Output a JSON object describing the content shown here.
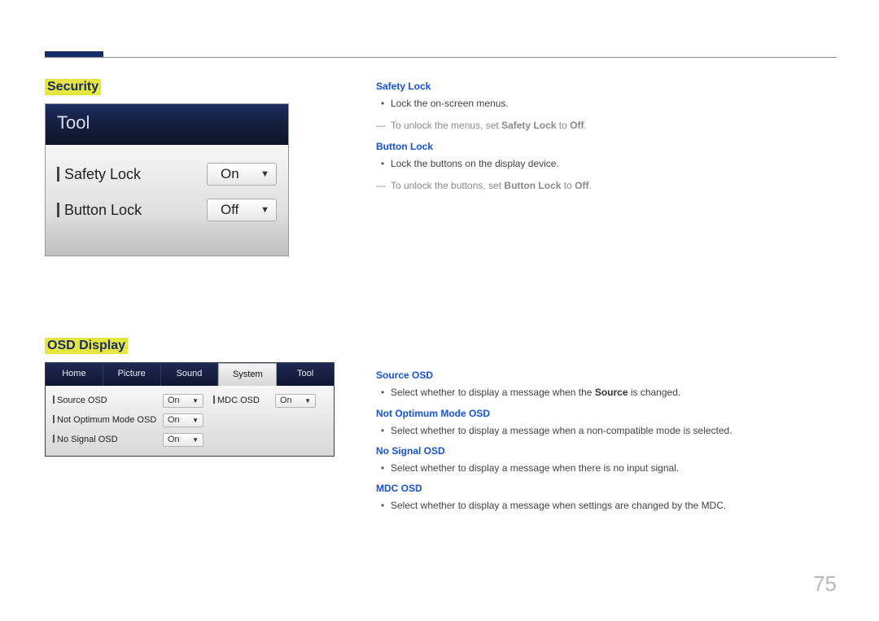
{
  "page_number": "75",
  "security": {
    "heading": "Security",
    "panel_title": "Tool",
    "rows": [
      {
        "label": "Safety Lock",
        "value": "On"
      },
      {
        "label": "Button Lock",
        "value": "Off"
      }
    ],
    "safety_lock": {
      "title": "Safety Lock",
      "bullet": "Lock the on-screen menus.",
      "note_pre": "To unlock the menus, set ",
      "note_bold": "Safety Lock",
      "note_mid": " to ",
      "note_bold2": "Off",
      "note_end": "."
    },
    "button_lock": {
      "title": "Button Lock",
      "bullet": "Lock the buttons on the display device.",
      "note_pre": "To unlock the buttons, set ",
      "note_bold": "Button Lock",
      "note_mid": " to ",
      "note_bold2": "Off",
      "note_end": "."
    }
  },
  "osd": {
    "heading": "OSD Display",
    "tabs": [
      "Home",
      "Picture",
      "Sound",
      "System",
      "Tool"
    ],
    "active_tab_index": 3,
    "rows": [
      {
        "name": "Source OSD",
        "val": "On",
        "name2": "MDC OSD",
        "val2": "On"
      },
      {
        "name": "Not Optimum Mode OSD",
        "val": "On"
      },
      {
        "name": "No Signal OSD",
        "val": "On"
      }
    ],
    "source_osd": {
      "title": "Source OSD",
      "bullet_pre": "Select whether to display a message when the ",
      "bullet_bold": "Source",
      "bullet_post": " is changed."
    },
    "not_optimum": {
      "title": "Not Optimum Mode OSD",
      "bullet": "Select whether to display a message when a non-compatible mode is selected."
    },
    "no_signal": {
      "title": "No Signal OSD",
      "bullet": "Select whether to display a message when there is no input signal."
    },
    "mdc": {
      "title": "MDC OSD",
      "bullet": "Select whether to display a message when settings are changed by the MDC."
    }
  }
}
